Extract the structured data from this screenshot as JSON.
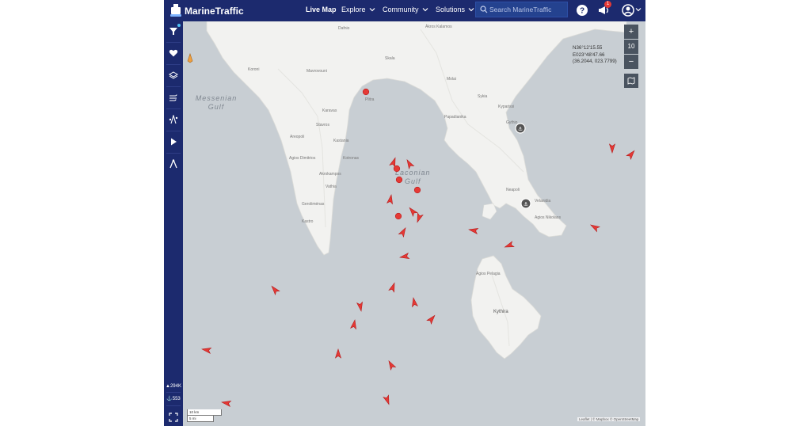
{
  "header": {
    "brand": "MarineTraffic",
    "nav": [
      "Live Map",
      "Explore",
      "Community",
      "Solutions"
    ],
    "search_placeholder": "Search MarineTraffic",
    "notification_count": "1"
  },
  "sidebar": {
    "vessel_count": "294K",
    "port_count": "553"
  },
  "map": {
    "zoom_level": "10",
    "coords": {
      "lat": "N36°12'15.55",
      "lon": "E023°48'47.66",
      "decimal": "(36.2044, 023.7799)"
    },
    "gulfs": {
      "messenian": "Messenian Gulf",
      "laconian_line1": "Laconian",
      "laconian_line2": "Gulf"
    },
    "island": "Kythira",
    "places": [
      "Dafnio",
      "Ákros Kalamos",
      "Skala",
      "Plitra",
      "Molai",
      "Gythio",
      "Sykia",
      "Areopoli",
      "Papadianika",
      "Kyparissi",
      "Karavas",
      "Agios Nikolaos",
      "Neapoli",
      "Kastro",
      "Koroni",
      "Akrokampos",
      "Kastania",
      "Velanidia",
      "Mavrovouni",
      "Agios Dimitrios",
      "Stavros",
      "Kotronas",
      "Vathia",
      "Geroliménas",
      "Ágios Pelagia"
    ],
    "scale": [
      "10 km",
      "5 mi"
    ],
    "attribution": "Leaflet | © Mapbox © OpenStreetMap"
  },
  "colors": {
    "topbar": "#1c2a6e",
    "sea": "#c8ced3",
    "land": "#f2f2f0",
    "vessel": "#e53935"
  }
}
